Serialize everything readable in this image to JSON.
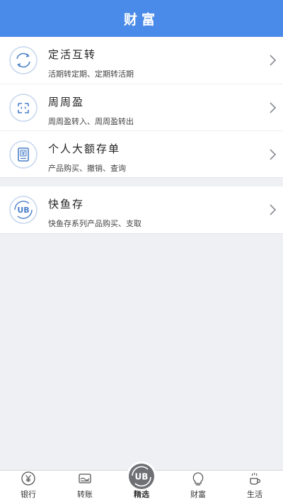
{
  "header": {
    "title": "财富"
  },
  "groups": [
    {
      "rows": [
        {
          "title": "定活互转",
          "subtitle": "活期转定期、定期转活期",
          "icon": "exchange-cycle-icon"
        },
        {
          "title": "周周盈",
          "subtitle": "周周盈转入、周周盈转出",
          "icon": "weekly-fund-icon"
        },
        {
          "title": "个人大额存单",
          "subtitle": "产品购买、撤销、查询",
          "icon": "deposit-certificate-icon"
        }
      ]
    },
    {
      "rows": [
        {
          "title": "快鱼存",
          "subtitle": "快鱼存系列产品购买、支取",
          "icon": "ub-logo-icon"
        }
      ]
    }
  ],
  "tabbar": {
    "tabs": [
      {
        "label": "银行",
        "icon": "bank-icon"
      },
      {
        "label": "转账",
        "icon": "transfer-icon"
      },
      {
        "label": "精选",
        "icon": "ub-logo-icon"
      },
      {
        "label": "财富",
        "icon": "wealth-icon"
      },
      {
        "label": "生活",
        "icon": "life-icon"
      }
    ],
    "active_index": 3
  },
  "colors": {
    "accent": "#4a8ae8",
    "icon_blue": "#4a7fc8",
    "background": "#eef0f3"
  }
}
